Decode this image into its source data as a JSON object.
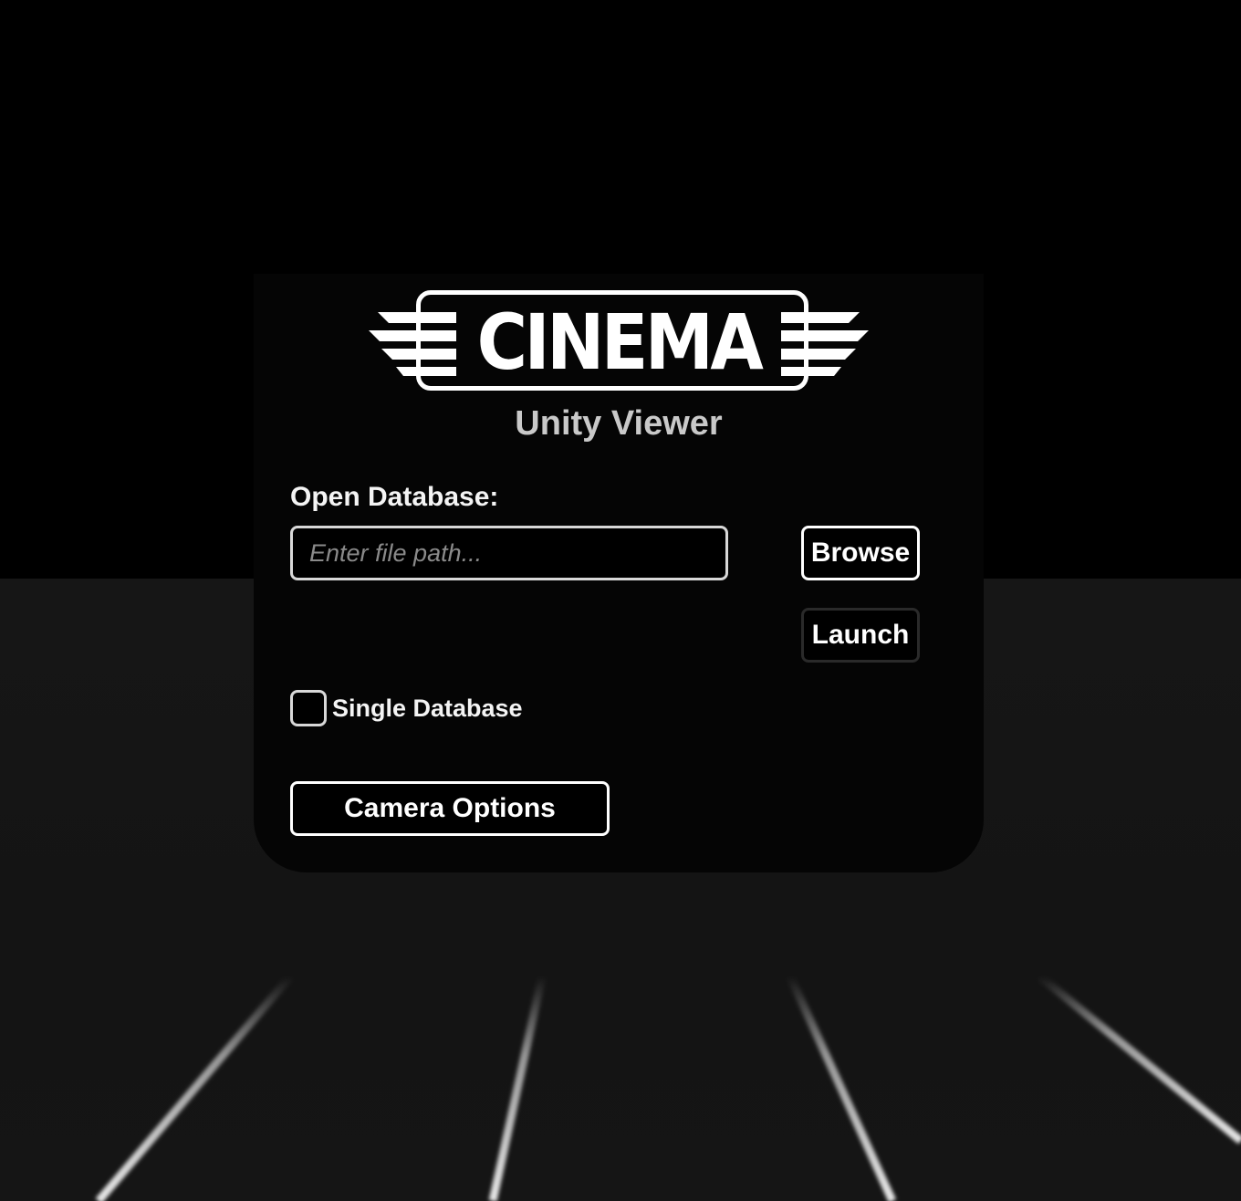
{
  "app": {
    "logo_text": "CINEMA",
    "subtitle": "Unity Viewer"
  },
  "database": {
    "label": "Open Database:",
    "path_value": "",
    "path_placeholder": "Enter file path...",
    "browse_label": "Browse",
    "launch_label": "Launch",
    "single_database_label": "Single Database",
    "single_database_checked": false
  },
  "camera": {
    "options_label": "Camera Options"
  },
  "colors": {
    "background": "#000000",
    "floor": "#151515",
    "panel": "#050505",
    "text": "#ffffff",
    "subtitle": "#c9c9c9",
    "placeholder": "#8a8a8a"
  },
  "icons": {
    "logo_wings": "chevron-wings-icon"
  }
}
